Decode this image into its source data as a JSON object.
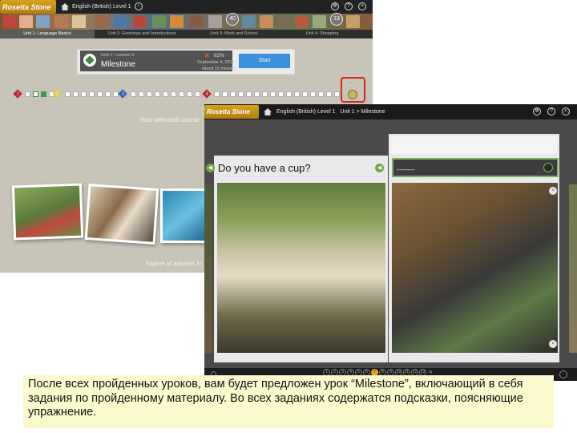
{
  "back_window": {
    "brand": "Rosetta Stone",
    "breadcrumb": "English (British) Level 1",
    "units": [
      {
        "label": "Unit 1: Language Basics",
        "active": true
      },
      {
        "label": "Unit 2: Greetings and Introductions",
        "active": false
      },
      {
        "label": "Unit 3: Work and School",
        "active": false
      },
      {
        "label": "Unit 4: Shopping",
        "active": false
      }
    ],
    "badge_numbers": [
      "40",
      "13"
    ],
    "lesson_card": {
      "subtitle": "Unit 1 • Lesson 5",
      "title": "Milestone",
      "score_percent": "62%",
      "date": "September 4, 2018",
      "duration": "About 10 minutes",
      "start_label": "Start"
    },
    "progress_markers": [
      "1",
      "2",
      "3",
      "4"
    ],
    "selected_course_text": "Your selected course",
    "explore_text": "Explore all activities fo",
    "icons": [
      "help-icon",
      "settings-icon",
      "close-icon"
    ]
  },
  "front_window": {
    "brand": "Rosetta Stone",
    "breadcrumb": "English (British) Level 1   Unit 1 > Milestone",
    "prompt": "Do you have a cup?",
    "answer_placeholder": "____",
    "pager_numbers": [
      "1",
      "2",
      "3",
      "4",
      "5",
      "6",
      "7",
      "8",
      "9",
      "10",
      "11",
      "12",
      "13"
    ],
    "pager_current": "7"
  },
  "caption": "После всех пройденных уроков, вам будет предложен урок “Milestone”, включающий в себя задания по пройденному материалу. Во всех заданиях содержатся подсказки, поясняющие упражнение.",
  "colors": {
    "highlight_red": "#d8241f",
    "start_blue": "#3c8fd8",
    "milestone_green": "#3e8a3a",
    "caption_bg": "#fbfacf",
    "accent_orange": "#e9a623"
  }
}
